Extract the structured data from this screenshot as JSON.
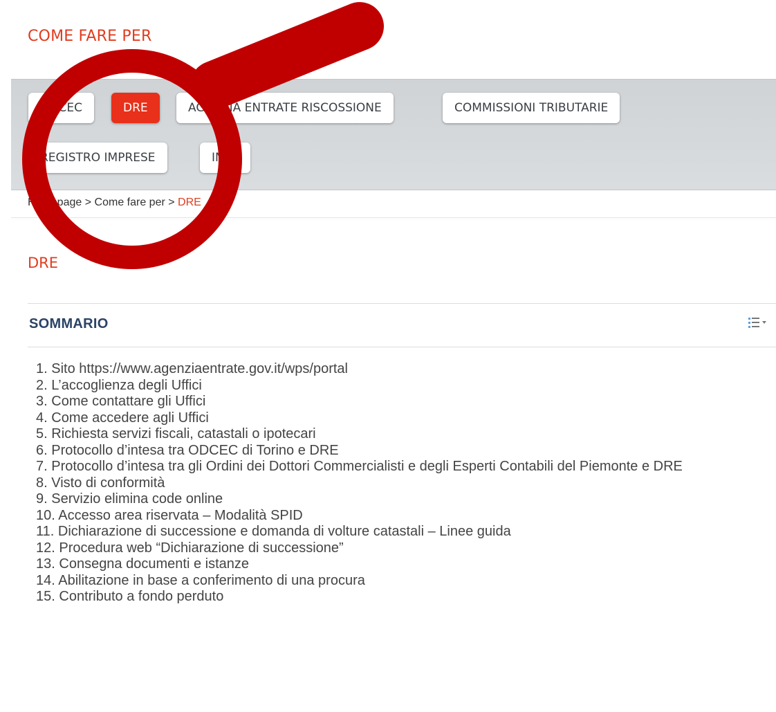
{
  "section_title": "COME FARE PER",
  "tabs": [
    {
      "label": "ODCEC",
      "active": false
    },
    {
      "label": "DRE",
      "active": true
    },
    {
      "label": "AGENZIA ENTRATE RISCOSSIONE",
      "active": false
    },
    {
      "label": "COMMISSIONI TRIBUTARIE",
      "active": false
    },
    {
      "label": "REGISTRO IMPRESE",
      "active": false
    },
    {
      "label": "INPS",
      "active": false
    }
  ],
  "breadcrumb": {
    "home": "Homepage",
    "sep1": ">",
    "parent": "Come fare per",
    "sep2": ">",
    "current": "DRE"
  },
  "page_title": "DRE",
  "toc": {
    "title": "SOMMARIO",
    "toggle_icon": "list-toggle-icon",
    "items": [
      {
        "num": "1.",
        "text": "Sito https://www.agenziaentrate.gov.it/wps/portal"
      },
      {
        "num": "2.",
        "text": "L’accoglienza degli Uffici"
      },
      {
        "num": "3.",
        "text": "Come contattare gli Uffici"
      },
      {
        "num": "4.",
        "text": "Come accedere agli Uffici"
      },
      {
        "num": "5.",
        "text": "Richiesta servizi fiscali, catastali o ipotecari"
      },
      {
        "num": "6.",
        "text": "Protocollo d’intesa tra ODCEC di Torino e DRE"
      },
      {
        "num": "7.",
        "text": "Protocollo d’intesa tra gli Ordini dei Dottori Commercialisti e  degli Esperti Contabili del Piemonte e DRE"
      },
      {
        "num": "8.",
        "text": "Visto di conformità"
      },
      {
        "num": "9.",
        "text": "Servizio elimina code online"
      },
      {
        "num": "10.",
        "text": "Accesso area riservata – Modalità SPID"
      },
      {
        "num": "11.",
        "text": "Dichiarazione di successione e domanda di volture catastali – Linee guida"
      },
      {
        "num": "12.",
        "text": "Procedura web “Dichiarazione di successione”"
      },
      {
        "num": "13.",
        "text": "Consegna documenti e istanze"
      },
      {
        "num": "14.",
        "text": "Abilitazione in base a conferimento di una procura"
      },
      {
        "num": "15.",
        "text": "Contributo a fondo perduto"
      }
    ]
  },
  "overlay": {
    "icon": "magnifying-glass-icon",
    "color": "#c00000"
  },
  "colors": {
    "accent": "#e03c1e",
    "active_tab": "#e8301a",
    "toc_title": "#2a4365"
  }
}
